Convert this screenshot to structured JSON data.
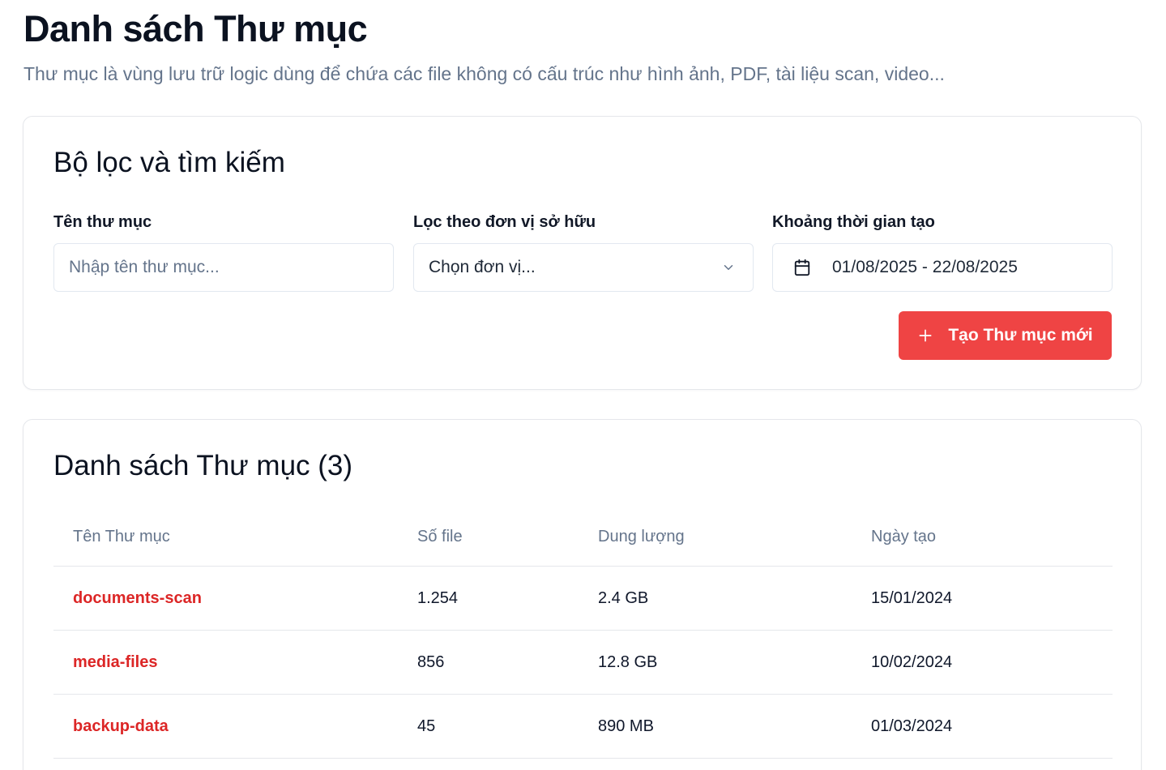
{
  "header": {
    "title": "Danh sách Thư mục",
    "subtitle": "Thư mục là vùng lưu trữ logic dùng để chứa các file không có cấu trúc như hình ảnh, PDF, tài liệu scan, video..."
  },
  "filters": {
    "title": "Bộ lọc và tìm kiếm",
    "name_field": {
      "label": "Tên thư mục",
      "placeholder": "Nhập tên thư mục...",
      "value": ""
    },
    "owner_field": {
      "label": "Lọc theo đơn vị sở hữu",
      "value": "Chọn đơn vị..."
    },
    "date_field": {
      "label": "Khoảng thời gian tạo",
      "value": "01/08/2025 - 22/08/2025"
    },
    "create_button_label": "Tạo Thư mục mới"
  },
  "list": {
    "title": "Danh sách Thư mục (3)",
    "columns": [
      "Tên Thư mục",
      "Số file",
      "Dung lượng",
      "Ngày tạo"
    ],
    "rows": [
      {
        "name": "documents-scan",
        "files": "1.254",
        "size": "2.4 GB",
        "created": "15/01/2024"
      },
      {
        "name": "media-files",
        "files": "856",
        "size": "12.8 GB",
        "created": "10/02/2024"
      },
      {
        "name": "backup-data",
        "files": "45",
        "size": "890 MB",
        "created": "01/03/2024"
      }
    ]
  },
  "colors": {
    "accent": "#ef4444",
    "link": "#dc2626",
    "muted": "#64748b",
    "border": "#e5e7eb"
  },
  "icons": {
    "owner_select": "chevron-down-icon",
    "date_range": "calendar-icon",
    "create_button": "plus-icon"
  }
}
